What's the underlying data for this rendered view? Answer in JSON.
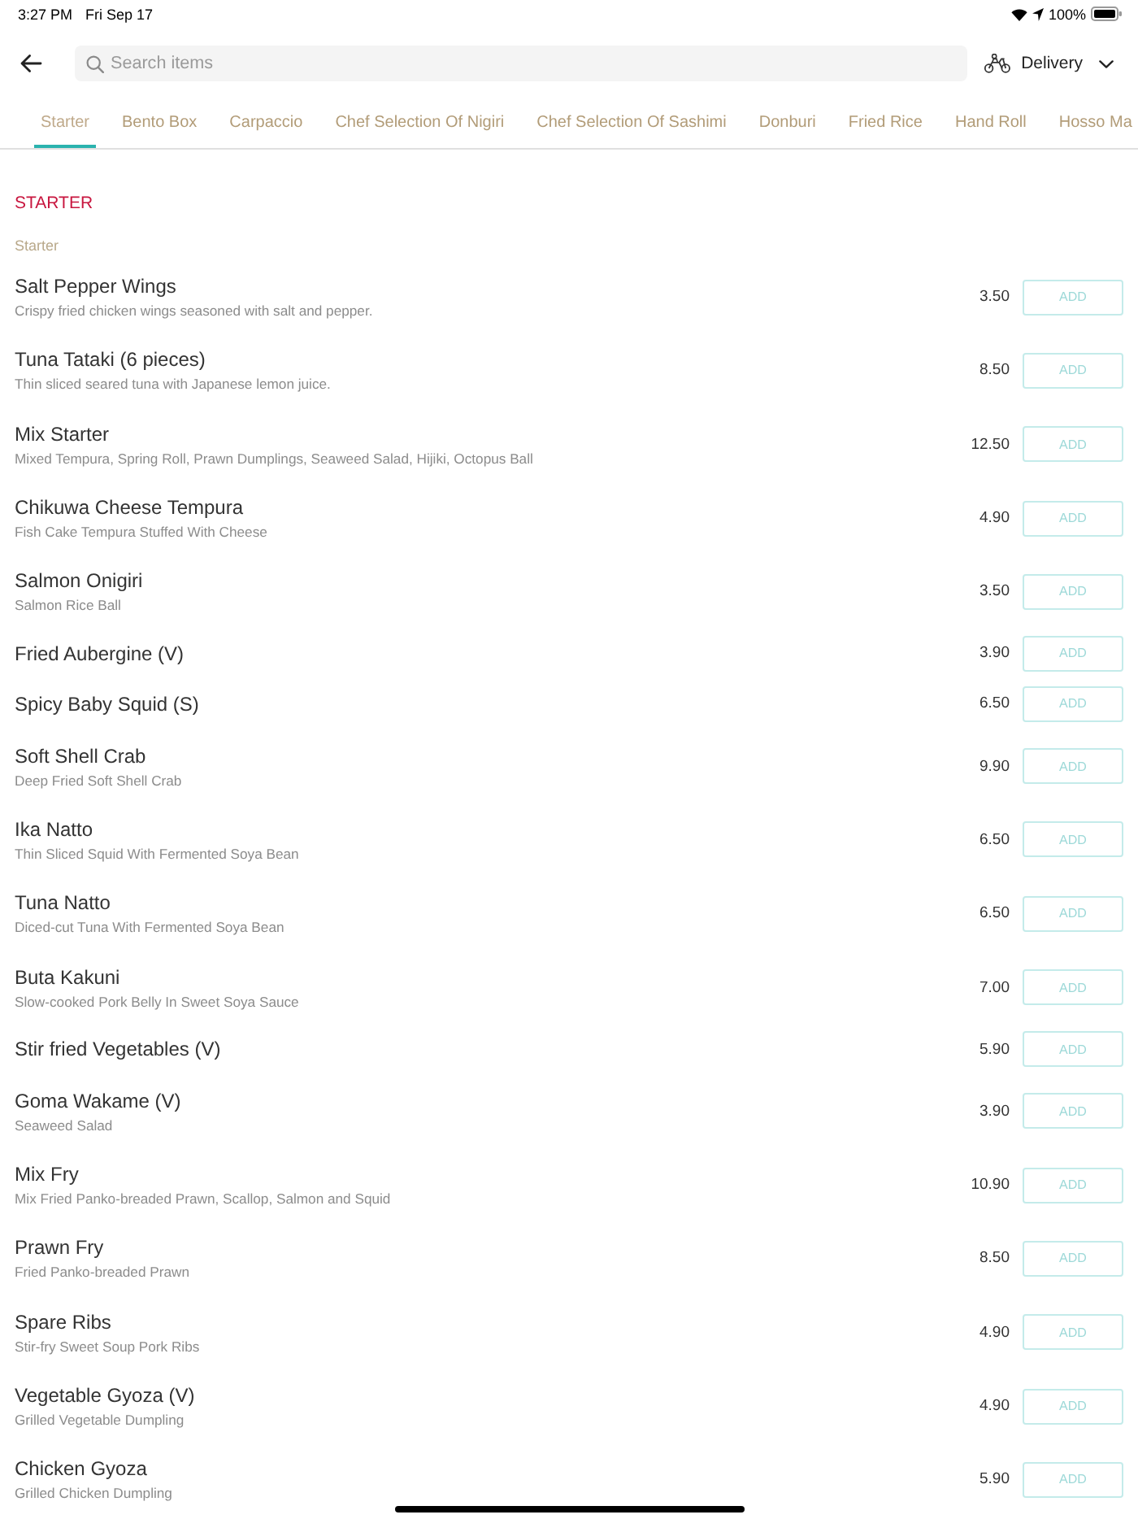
{
  "status_bar": {
    "time": "3:27 PM",
    "date": "Fri Sep 17",
    "battery": "100%"
  },
  "toolbar": {
    "search": {
      "placeholder": "Search items"
    },
    "mode": {
      "label": "Delivery"
    }
  },
  "tabs": [
    {
      "label": "Starter",
      "selected": true
    },
    {
      "label": "Bento Box",
      "selected": false
    },
    {
      "label": "Carpaccio",
      "selected": false
    },
    {
      "label": "Chef Selection Of Nigiri",
      "selected": false
    },
    {
      "label": "Chef Selection Of Sashimi",
      "selected": false
    },
    {
      "label": "Donburi",
      "selected": false
    },
    {
      "label": "Fried Rice",
      "selected": false
    },
    {
      "label": "Hand Roll",
      "selected": false
    },
    {
      "label": "Hosso Ma",
      "selected": false
    }
  ],
  "section": {
    "title": "STARTER",
    "subtitle": "Starter",
    "items": [
      {
        "name": "Salt Pepper Wings",
        "description": "Crispy fried chicken wings seasoned with salt and pepper.",
        "price": "3.50",
        "button": "ADD"
      },
      {
        "name": "Tuna Tataki (6 pieces)",
        "description": "Thin sliced seared tuna with Japanese lemon juice.",
        "price": "8.50",
        "button": "ADD"
      },
      {
        "name": "Mix Starter",
        "description": "Mixed Tempura, Spring Roll, Prawn Dumplings, Seaweed Salad, Hijiki, Octopus Ball",
        "price": "12.50",
        "button": "ADD"
      },
      {
        "name": "Chikuwa Cheese Tempura",
        "description": "Fish Cake Tempura Stuffed With Cheese",
        "price": "4.90",
        "button": "ADD"
      },
      {
        "name": "Salmon Onigiri",
        "description": "Salmon Rice Ball",
        "price": "3.50",
        "button": "ADD"
      },
      {
        "name": "Fried Aubergine (V)",
        "price": "3.90",
        "button": "ADD"
      },
      {
        "name": "Spicy Baby Squid (S)",
        "price": "6.50",
        "button": "ADD"
      },
      {
        "name": "Soft Shell Crab",
        "description": "Deep Fried Soft Shell Crab",
        "price": "9.90",
        "button": "ADD"
      },
      {
        "name": "Ika Natto",
        "description": "Thin Sliced Squid With Fermented Soya Bean",
        "price": "6.50",
        "button": "ADD"
      },
      {
        "name": "Tuna Natto",
        "description": "Diced-cut Tuna With Fermented Soya Bean",
        "price": "6.50",
        "button": "ADD"
      },
      {
        "name": "Buta Kakuni",
        "description": "Slow-cooked Pork Belly In Sweet Soya Sauce",
        "price": "7.00",
        "button": "ADD"
      },
      {
        "name": "Stir fried Vegetables (V)",
        "price": "5.90",
        "button": "ADD"
      },
      {
        "name": "Goma Wakame (V)",
        "description": "Seaweed Salad",
        "price": "3.90",
        "button": "ADD"
      },
      {
        "name": "Mix Fry",
        "description": "Mix Fried Panko-breaded Prawn, Scallop, Salmon and Squid",
        "price": "10.90",
        "button": "ADD"
      },
      {
        "name": "Prawn Fry",
        "description": "Fried Panko-breaded Prawn",
        "price": "8.50",
        "button": "ADD"
      },
      {
        "name": "Spare Ribs",
        "description": "Stir-fry Sweet Soup Pork Ribs",
        "price": "4.90",
        "button": "ADD"
      },
      {
        "name": "Vegetable Gyoza (V)",
        "description": "Grilled Vegetable Dumpling",
        "price": "4.90",
        "button": "ADD"
      },
      {
        "name": "Chicken Gyoza",
        "description": "Grilled Chicken Dumpling",
        "price": "5.90",
        "button": "ADD"
      }
    ]
  }
}
